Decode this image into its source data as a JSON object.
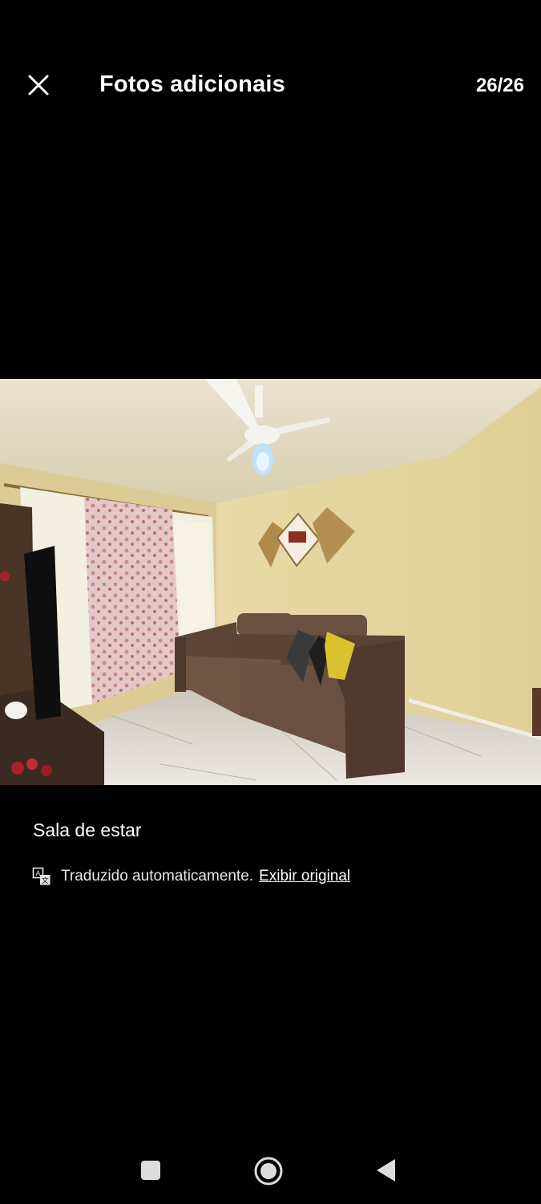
{
  "header": {
    "close_icon": "close-icon",
    "title": "Fotos adicionais",
    "counter": "26/26"
  },
  "photo": {
    "alt": "Sala de estar"
  },
  "caption": "Sala de estar",
  "translation": {
    "icon": "translate-icon",
    "notice": "Traduzido automaticamente.",
    "link": "Exibir original"
  },
  "navigation_bar": {
    "buttons": [
      "recents-square-icon",
      "home-circle-icon",
      "back-triangle-icon"
    ]
  },
  "colors": {
    "background": "#000000",
    "text": "#ffffff"
  }
}
